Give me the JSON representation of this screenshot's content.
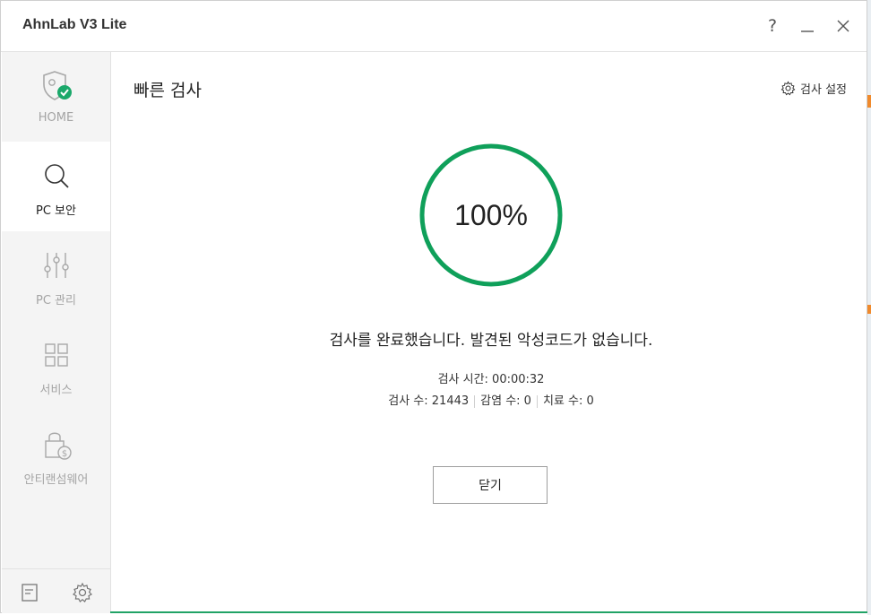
{
  "window": {
    "title": "AhnLab V3 Lite",
    "help_icon": "help-icon",
    "minimize_icon": "minimize-icon",
    "close_icon": "close-icon"
  },
  "sidebar": {
    "items": [
      {
        "label": "HOME",
        "icon": "shield-check-icon",
        "active": false
      },
      {
        "label": "PC 보안",
        "icon": "search-icon",
        "active": true
      },
      {
        "label": "PC 관리",
        "icon": "sliders-icon",
        "active": false
      },
      {
        "label": "서비스",
        "icon": "grid-icon",
        "active": false
      },
      {
        "label": "안티랜섬웨어",
        "icon": "lock-dollar-icon",
        "active": false
      }
    ],
    "bottom_icons": [
      "document-icon",
      "gear-icon"
    ]
  },
  "main": {
    "title": "빠른 검사",
    "settings_label": "검사 설정",
    "progress": {
      "value": 1.0,
      "label": "100%"
    },
    "message": "검사를 완료했습니다. 발견된 악성코드가 없습니다.",
    "scan_time_label": "검사 시간: 00:00:32",
    "stats": {
      "scanned": "검사 수: 21443",
      "infected": "감염 수: 0",
      "cured": "치료 수: 0"
    },
    "close_button": "닫기"
  },
  "colors": {
    "accent_green": "#0fa05a",
    "check_green": "#1aa86a",
    "side_bg": "#f4f4f4",
    "icon_gray": "#a8a8a8"
  }
}
